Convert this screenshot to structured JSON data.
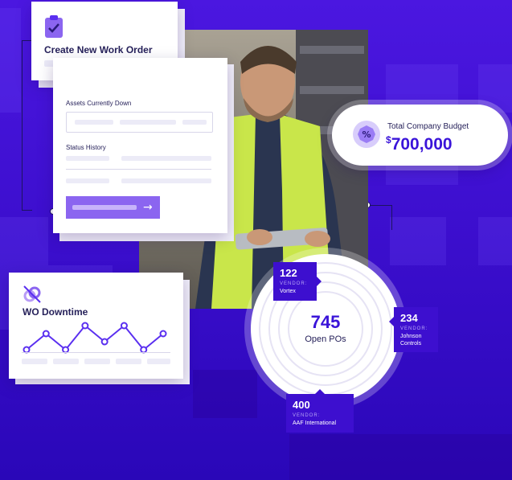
{
  "work_order": {
    "title": "Create New Work Order"
  },
  "form": {
    "assets_label": "Assets Currently Down",
    "status_label": "Status History",
    "submit_icon": "arrow-right-icon"
  },
  "budget": {
    "label": "Total Company Budget",
    "currency": "$",
    "value": "700,000",
    "icon": "percent-icon"
  },
  "downtime": {
    "title": "WO Downtime",
    "icon": "broken-link-icon",
    "chart_data": {
      "type": "line",
      "values": [
        1,
        3,
        1,
        4,
        2,
        4,
        1,
        3
      ]
    }
  },
  "pos": {
    "total": "745",
    "label": "Open POs",
    "vendors": [
      {
        "count": "122",
        "tag": "VENDOR:",
        "name": "Vortex"
      },
      {
        "count": "234",
        "tag": "VENDOR:",
        "name": "Johnson Controls"
      },
      {
        "count": "400",
        "tag": "VENDOR:",
        "name": "AAF International"
      }
    ]
  },
  "colors": {
    "accent": "#5a2ff0",
    "purple_button": "#8b65f0",
    "navy": "#1d1460"
  }
}
